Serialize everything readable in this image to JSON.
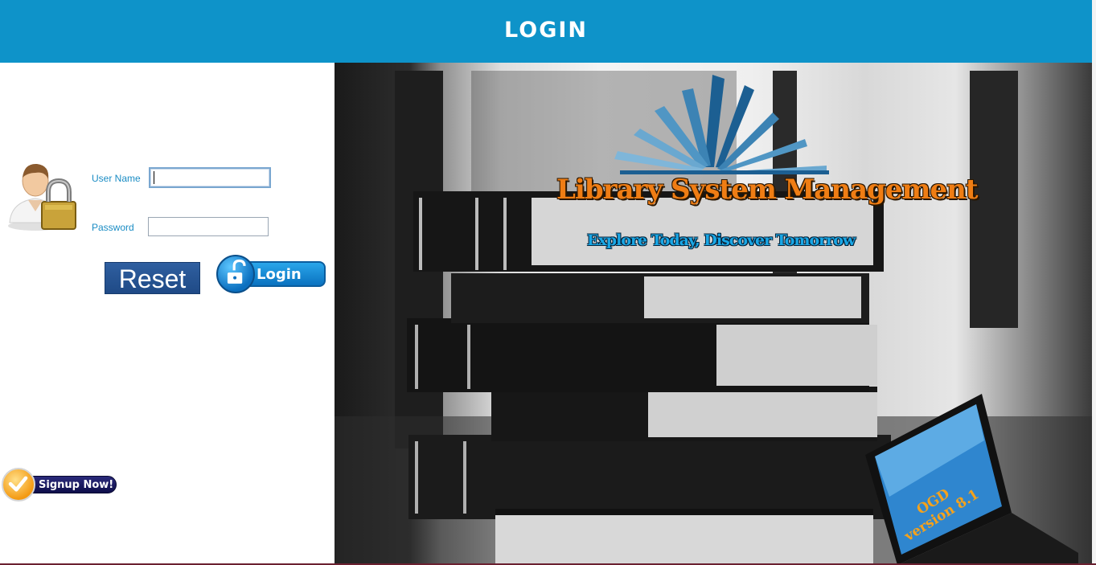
{
  "window": {
    "title": "LOGIN"
  },
  "form": {
    "username_label": "User Name",
    "username_value": "",
    "password_label": "Password",
    "password_value": "",
    "reset_label": "Reset",
    "login_label": "Login",
    "signup_label": "Signup Now!"
  },
  "icons": {
    "user_lock": "user-lock-icon",
    "unlock": "unlock-icon",
    "checkmark": "checkmark-icon"
  },
  "hero": {
    "title": "Library System Management",
    "tagline": "Explore Today, Discover Tomorrow",
    "laptop_line1": "OGD",
    "laptop_line2": "version 8.1"
  },
  "colors": {
    "header": "#0e93c9",
    "label": "#1a8cc4",
    "reset_button": "#2a5a9a",
    "login_button": "#1a8ad8",
    "brand_orange": "#ef7d14",
    "tagline_blue": "#19a7e6"
  }
}
